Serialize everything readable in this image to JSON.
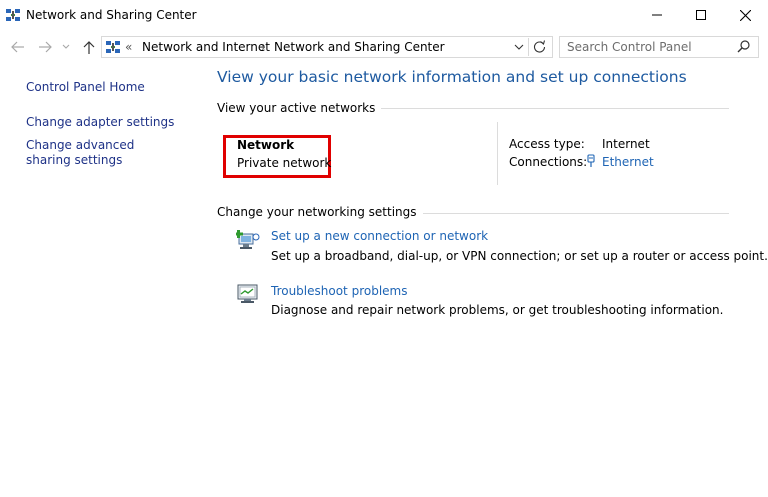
{
  "window": {
    "title": "Network and Sharing Center",
    "minimize_label": "—",
    "maximize_label": "☐",
    "close_label": "✕"
  },
  "addressbar": {
    "overflow": "«",
    "crumbs": [
      "Network and Internet",
      "Network and Sharing Center"
    ],
    "separator": "›"
  },
  "search": {
    "placeholder": "Search Control Panel"
  },
  "sidebar": {
    "items": [
      {
        "label": "Control Panel Home"
      },
      {
        "label": "Change adapter settings"
      },
      {
        "label": "Change advanced sharing settings"
      }
    ]
  },
  "main": {
    "title": "View your basic network information and set up connections",
    "active_networks_label": "View your active networks",
    "network": {
      "name": "Network",
      "type": "Private network",
      "access_type_label": "Access type:",
      "access_type_value": "Internet",
      "connections_label": "Connections:",
      "connections_value": "Ethernet"
    },
    "change_settings_label": "Change your networking settings",
    "tasks": [
      {
        "link": "Set up a new connection or network",
        "description": "Set up a broadband, dial-up, or VPN connection; or set up a router or access point."
      },
      {
        "link": "Troubleshoot problems",
        "description": "Diagnose and repair network problems, or get troubleshooting information."
      }
    ]
  },
  "colors": {
    "accent": "#1e5aa0",
    "link": "#1e64b4",
    "highlight_border": "#e00000"
  },
  "icons": {
    "title": "network-icon",
    "back": "back-arrow-icon",
    "forward": "forward-arrow-icon",
    "recent": "chevron-down-icon",
    "up": "up-arrow-icon",
    "refresh": "refresh-icon",
    "search": "search-icon",
    "ethernet": "ethernet-icon",
    "new_connection": "new-connection-icon",
    "troubleshoot": "troubleshoot-icon"
  }
}
